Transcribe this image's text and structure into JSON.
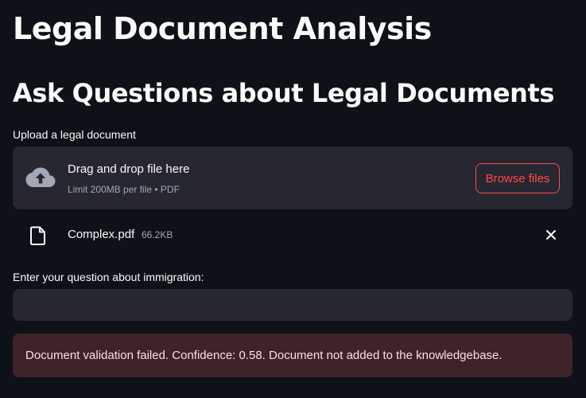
{
  "title": "Legal Document Analysis",
  "subtitle": "Ask Questions about Legal Documents",
  "uploader": {
    "label": "Upload a legal document",
    "dropzone_text": "Drag and drop file here",
    "limit_text": "Limit 200MB per file • PDF",
    "browse_label": "Browse files",
    "upload_icon": "cloud-upload-icon"
  },
  "uploaded_file": {
    "name": "Complex.pdf",
    "size": "66.2KB",
    "file_icon": "file-icon",
    "remove_icon": "close-icon"
  },
  "question": {
    "label": "Enter your question about immigration:",
    "value": "",
    "placeholder": ""
  },
  "alert": {
    "message": "Document validation failed. Confidence: 0.58. Document not added to the knowledgebase."
  },
  "colors": {
    "background": "#0e1117",
    "surface": "#262730",
    "accent": "#ff4b4b",
    "error_bg": "#3e2428",
    "error_text": "#ffdede"
  }
}
